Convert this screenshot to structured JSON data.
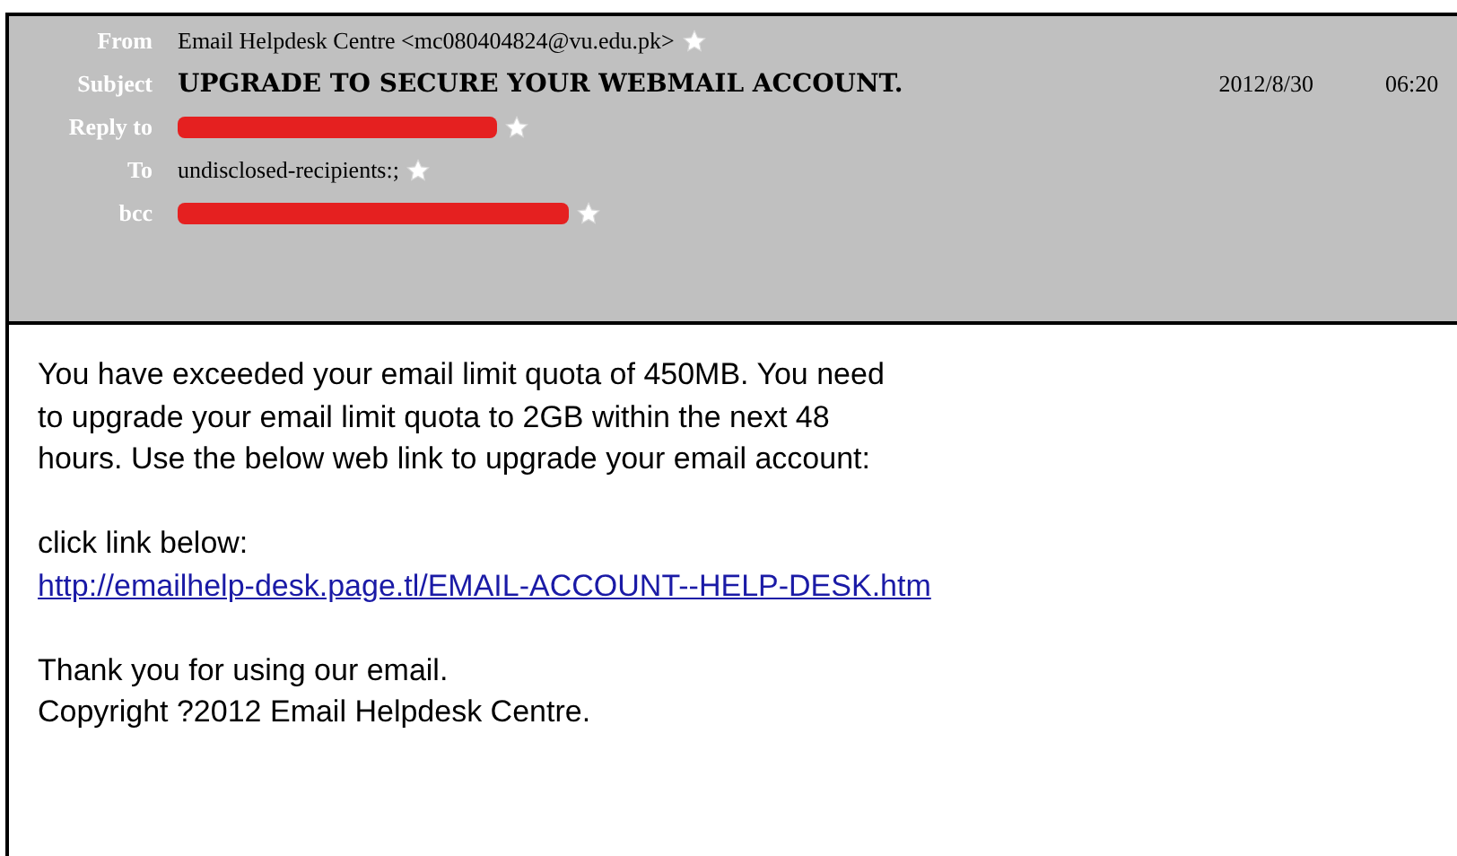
{
  "header": {
    "fields": [
      {
        "label": "From",
        "kind": "text",
        "value": "Email Helpdesk Centre <mc080404824@vu.edu.pk>",
        "starred": true
      },
      {
        "label": "Subject",
        "kind": "subject",
        "value": "UPGRADE TO SECURE YOUR WEBMAIL ACCOUNT.",
        "date": "2012/8/30",
        "time": "06:20",
        "starred": false
      },
      {
        "label": "Reply to",
        "kind": "redacted",
        "starred": true
      },
      {
        "label": "To",
        "kind": "text",
        "value": "undisclosed-recipients:;",
        "starred": true
      },
      {
        "label": "bcc",
        "kind": "redacted",
        "starred": true
      }
    ]
  },
  "body": {
    "paragraphs": [
      {
        "kind": "text",
        "lines": [
          "You have exceeded your email limit quota of 450MB. You need",
          "to upgrade your email limit quota to 2GB within the next 48",
          "hours. Use the below web link to upgrade your email account:"
        ]
      },
      {
        "kind": "text",
        "lines": [
          "click link below:"
        ]
      },
      {
        "kind": "link",
        "lines": [
          "http://emailhelp-desk.page.tl/EMAIL-ACCOUNT--HELP-DESK.htm"
        ]
      },
      {
        "kind": "gap"
      },
      {
        "kind": "text",
        "lines": [
          "Thank you for using our email.",
          "Copyright ?2012 Email Helpdesk Centre."
        ]
      }
    ]
  }
}
